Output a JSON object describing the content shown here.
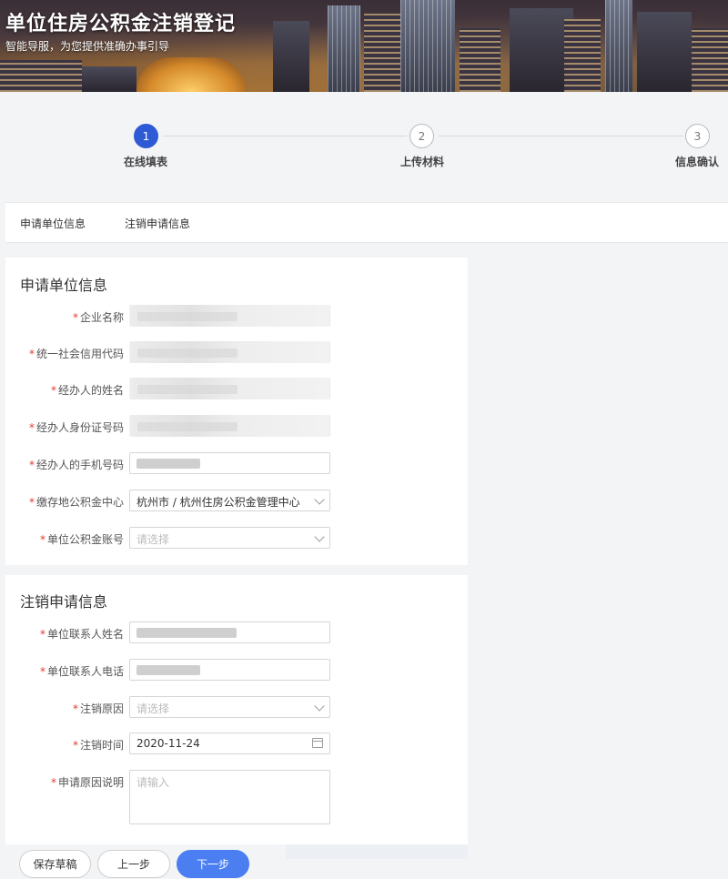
{
  "banner": {
    "title": "单位住房公积金注销登记",
    "subtitle": "智能导服，为您提供准确办事引导"
  },
  "steps": [
    {
      "number": "1",
      "label": "在线填表",
      "active": true
    },
    {
      "number": "2",
      "label": "上传材料",
      "active": false
    },
    {
      "number": "3",
      "label": "信息确认",
      "active": false
    }
  ],
  "tabs": [
    "申请单位信息",
    "注销申请信息"
  ],
  "section1": {
    "title": "申请单位信息",
    "fields": {
      "company_name": {
        "label": "企业名称"
      },
      "credit_code": {
        "label": "统一社会信用代码"
      },
      "handler_name": {
        "label": "经办人的姓名"
      },
      "handler_id": {
        "label": "经办人身份证号码"
      },
      "handler_phone": {
        "label": "经办人的手机号码"
      },
      "deposit_center": {
        "label": "缴存地公积金中心",
        "value": "杭州市 / 杭州住房公积金管理中心"
      },
      "account": {
        "label": "单位公积金账号",
        "placeholder": "请选择"
      }
    }
  },
  "section2": {
    "title": "注销申请信息",
    "fields": {
      "contact_name": {
        "label": "单位联系人姓名"
      },
      "contact_phone": {
        "label": "单位联系人电话"
      },
      "reason": {
        "label": "注销原因",
        "placeholder": "请选择"
      },
      "date": {
        "label": "注销时间",
        "value": "2020-11-24"
      },
      "reason_desc": {
        "label": "申请原因说明",
        "placeholder": "请输入"
      }
    }
  },
  "buttons": {
    "save": "保存草稿",
    "prev": "上一步",
    "next": "下一步"
  },
  "colors": {
    "primary": "#4a7ef1",
    "step_active": "#2e5bd5",
    "required": "#e23b2e"
  }
}
